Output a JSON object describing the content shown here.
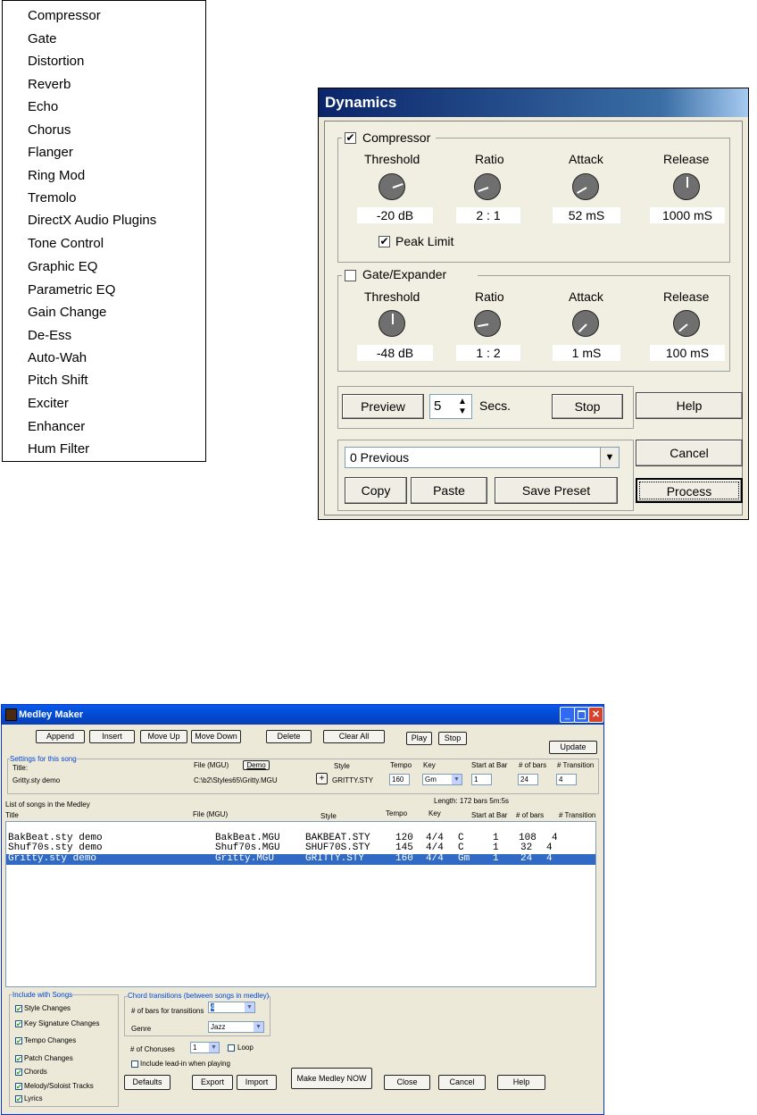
{
  "effects_menu": {
    "items": [
      "Compressor",
      "Gate",
      "Distortion",
      "Reverb",
      "Echo",
      "Chorus",
      "Flanger",
      "Ring Mod",
      "Tremolo",
      "DirectX Audio Plugins",
      "Tone Control",
      "Graphic EQ",
      "Parametric EQ",
      "Gain Change",
      "De-Ess",
      "Auto-Wah",
      "Pitch Shift",
      "Exciter",
      "Enhancer",
      "Hum Filter"
    ]
  },
  "dynamics": {
    "title": "Dynamics",
    "compressor": {
      "label": "Compressor",
      "checked": true,
      "col_labels": [
        "Threshold",
        "Ratio",
        "Attack",
        "Release"
      ],
      "values": [
        "-20 dB",
        "2 : 1",
        "52 mS",
        "1000 mS"
      ],
      "peak_limit_label": "Peak Limit",
      "peak_limit_checked": true
    },
    "gate": {
      "label": "Gate/Expander",
      "checked": false,
      "col_labels": [
        "Threshold",
        "Ratio",
        "Attack",
        "Release"
      ],
      "values": [
        "-48 dB",
        "1 : 2",
        "1 mS",
        "100 mS"
      ]
    },
    "preview_label": "Preview",
    "secs_value": "5",
    "secs_label": "Secs.",
    "stop_label": "Stop",
    "help_label": "Help",
    "preset_value": "0 Previous",
    "cancel_label": "Cancel",
    "copy_label": "Copy",
    "paste_label": "Paste",
    "save_preset_label": "Save Preset",
    "process_label": "Process"
  },
  "medley": {
    "title": "Medley Maker",
    "toolbar": {
      "append": "Append",
      "insert": "Insert",
      "move_up": "Move Up",
      "move_down": "Move Down",
      "delete": "Delete",
      "clear_all": "Clear All",
      "play": "Play",
      "stop": "Stop",
      "update": "Update"
    },
    "settings": {
      "group_label": "Settings for this song",
      "title_label": "Title:",
      "title_value": "Gritty.sty demo",
      "file_label": "File (MGU)",
      "demo_button": "Demo",
      "file_value": "C:\\b2\\Styles65\\Gritty.MGU",
      "style_label": "Style",
      "style_plus": "+",
      "style_value": "GRITTY.STY",
      "tempo_label": "Tempo",
      "tempo_value": "160",
      "key_label": "Key",
      "key_value": "Gm",
      "start_label": "Start at Bar",
      "start_value": "1",
      "bars_label": "# of bars",
      "bars_value": "24",
      "transition_label": "# Transition",
      "transition_value": "4"
    },
    "list": {
      "caption": "List of songs in the Medley",
      "length": "Length:  172 bars  5m:5s",
      "headers": [
        "Title",
        "File (MGU)",
        "Style",
        "Tempo",
        "Key",
        "Start at Bar",
        "# of bars",
        "# Transition"
      ],
      "rows": [
        {
          "title": "BakBeat.sty demo",
          "file": "BakBeat.MGU",
          "style": "BAKBEAT.STY",
          "tempo": "120",
          "key": "4/4",
          "key2": "C",
          "start": "1",
          "bars": "108",
          "trans": "4",
          "selected": false
        },
        {
          "title": "Shuf70s.sty demo",
          "file": "Shuf70s.MGU",
          "style": "SHUF70S.STY",
          "tempo": "145",
          "key": "4/4",
          "key2": "C",
          "start": "1",
          "bars": "32",
          "trans": "4",
          "selected": false
        },
        {
          "title": "Gritty.sty demo",
          "file": "Gritty.MGU",
          "style": "GRITTY.STY",
          "tempo": "160",
          "key": "4/4",
          "key2": "Gm",
          "start": "1",
          "bars": "24",
          "trans": "4",
          "selected": true
        }
      ]
    },
    "include": {
      "group_label": "Include with Songs",
      "items": [
        "Style Changes",
        "Key Signature Changes",
        "Tempo Changes",
        "Patch Changes",
        "Chords",
        "Melody/Soloist Tracks",
        "Lyrics"
      ]
    },
    "transitions": {
      "group_label": "Chord transitions (between songs in medley)",
      "bars_label": "# of bars for transitions",
      "bars_value": "4",
      "genre_label": "Genre",
      "genre_value": "Jazz"
    },
    "choruses_label": "# of Choruses",
    "choruses_value": "1",
    "loop_label": "Loop",
    "leadin_label": "Include lead-in when playing",
    "bottom": {
      "defaults": "Defaults",
      "export": "Export",
      "import": "Import",
      "make": "Make Medley NOW",
      "close": "Close",
      "cancel": "Cancel",
      "help": "Help"
    },
    "colors": {
      "selection": "#316ac5",
      "titlebar": "#0a5ae6",
      "checkmark": "#21a121"
    }
  }
}
